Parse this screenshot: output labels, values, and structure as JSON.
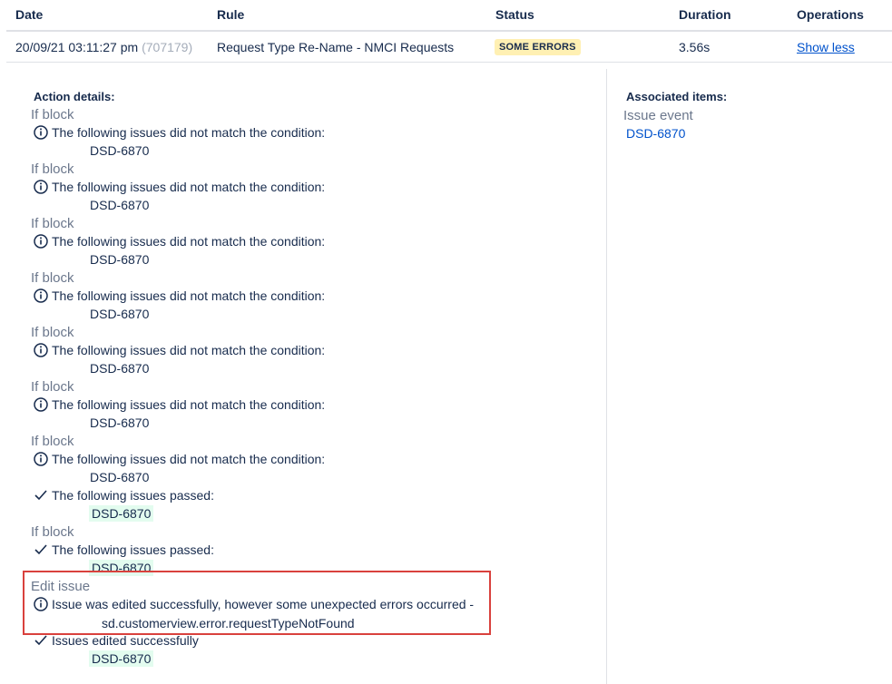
{
  "table": {
    "headers": [
      "Date",
      "Rule",
      "Status",
      "Duration",
      "Operations"
    ],
    "row": {
      "date": "20/09/21 03:11:27 pm",
      "id": "(707179)",
      "rule": "Request Type Re-Name - NMCI Requests",
      "status": "SOME ERRORS",
      "duration": "3.56s",
      "operation": "Show less"
    }
  },
  "action_details": {
    "title": "Action details:",
    "if_block_label": "If block",
    "not_match_message": "The following issues did not match the condition:",
    "passed_message": "The following issues passed:",
    "issue_key": "DSD-6870",
    "edit_issue_label": "Edit issue",
    "edit_warning": "Issue was edited successfully, however some unexpected errors occurred -",
    "edit_error_detail": "sd.customerview.error.requestTypeNotFound",
    "edited_success": "Issues edited successfully"
  },
  "associated_items": {
    "title": "Associated items:",
    "label": "Issue event",
    "issue_key": "DSD-6870"
  },
  "icons": {
    "info": "info-icon",
    "check": "check-icon"
  },
  "colors": {
    "link": "#0052cc",
    "lozenge_bg": "#fff0b3",
    "passed_bg": "#e3fcef",
    "highlight_border": "#d9413d"
  }
}
